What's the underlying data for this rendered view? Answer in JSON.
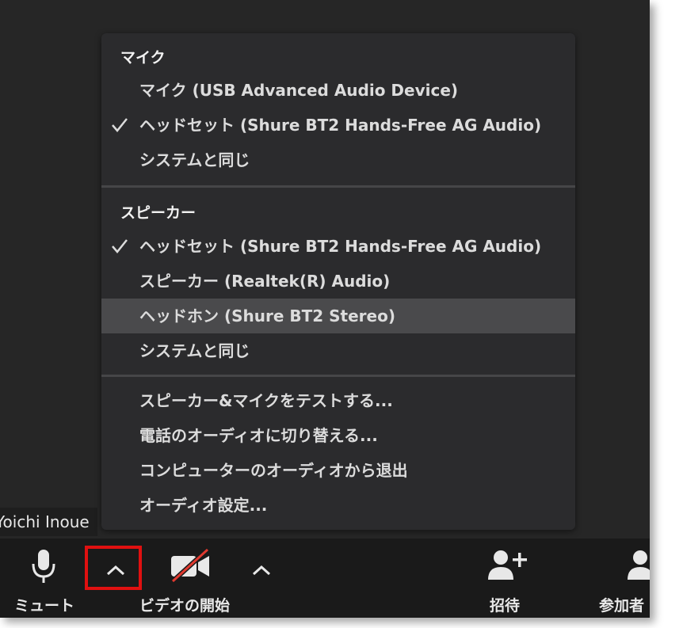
{
  "participant_name": "Yoichi Inoue",
  "menu": {
    "mic_header": "マイク",
    "mic_items": [
      {
        "label": "マイク (USB Advanced Audio Device)",
        "checked": false
      },
      {
        "label": "ヘッドセット (Shure BT2 Hands-Free AG Audio)",
        "checked": true
      },
      {
        "label": "システムと同じ",
        "checked": false
      }
    ],
    "speaker_header": "スピーカー",
    "speaker_items": [
      {
        "label": "ヘッドセット (Shure BT2 Hands-Free AG Audio)",
        "checked": true
      },
      {
        "label": "スピーカー (Realtek(R) Audio)",
        "checked": false
      },
      {
        "label": "ヘッドホン (Shure BT2 Stereo)",
        "checked": false,
        "highlighted": true
      },
      {
        "label": "システムと同じ",
        "checked": false
      }
    ],
    "actions": [
      "スピーカー&マイクをテストする...",
      "電話のオーディオに切り替える...",
      "コンピューターのオーディオから退出",
      "オーディオ設定..."
    ]
  },
  "toolbar": {
    "mute_label": "ミュート",
    "video_label": "ビデオの開始",
    "invite_label": "招待",
    "participants_label": "参加者"
  },
  "colors": {
    "menu_bg": "#2b2b2d",
    "highlight": "#4a4a4c",
    "toolbar_bg": "#1a1a1a",
    "annotation_red": "#e01010",
    "video_off_slash": "#e0392f"
  }
}
